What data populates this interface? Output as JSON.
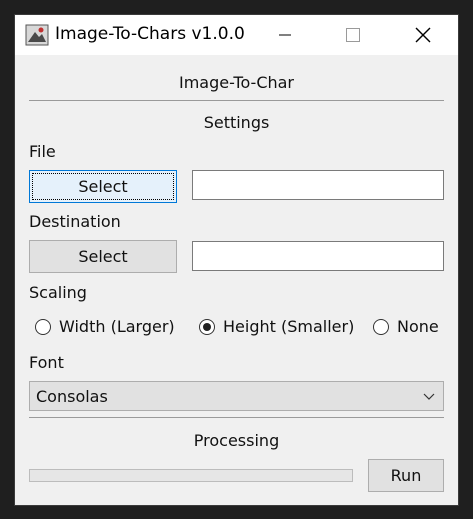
{
  "window": {
    "title": "Image-To-Chars v1.0.0"
  },
  "app": {
    "heading": "Image-To-Char",
    "settings_label": "Settings",
    "processing_label": "Processing"
  },
  "file": {
    "label": "File",
    "button_label": "Select",
    "path_value": ""
  },
  "destination": {
    "label": "Destination",
    "button_label": "Select",
    "path_value": ""
  },
  "scaling": {
    "label": "Scaling",
    "options": [
      {
        "label": "Width (Larger)",
        "selected": false
      },
      {
        "label": "Height (Smaller)",
        "selected": true
      },
      {
        "label": "None",
        "selected": false
      }
    ]
  },
  "font": {
    "label": "Font",
    "selected": "Consolas"
  },
  "progress": {
    "value": 0
  },
  "run_button_label": "Run",
  "colors": {
    "focus_border": "#0078d7",
    "focus_fill": "#e5f1fb",
    "button_face": "#e1e1e1",
    "progress_fill": "#06b025"
  },
  "icons": [
    "app-icon",
    "minimize-icon",
    "maximize-icon",
    "close-icon",
    "chevron-down-icon"
  ]
}
